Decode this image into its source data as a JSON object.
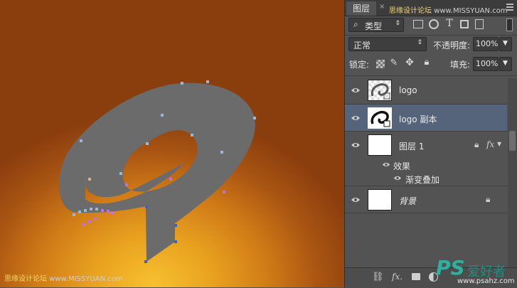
{
  "watermarks": {
    "tab_wm": {
      "a": "思缘设计论坛",
      "b": "www.MISSYUAN.com"
    },
    "canvas_wm": {
      "a": "思缘设计论坛",
      "b": "www.MISSYUAN.com"
    },
    "corner": {
      "ps": "PS",
      "cn": "爱好者",
      "url": "www.psahz.com"
    }
  },
  "panel": {
    "tab_label": "图层",
    "tab_close": "×",
    "filter_label": "类型",
    "blend_mode": "正常",
    "opacity_label": "不透明度:",
    "opacity_value": "100%",
    "lock_label": "锁定:",
    "fill_label": "填充:",
    "fill_value": "100%",
    "layers": [
      {
        "name": "logo"
      },
      {
        "name": "logo 副本"
      },
      {
        "name": "图层 1",
        "fx": "fx"
      },
      {
        "name": "背景"
      }
    ],
    "effects_label": "效果",
    "effect_name": "渐变叠加",
    "bottom_fx": "fx."
  },
  "colors": {
    "panel_bg": "#535353",
    "selected_layer": "#55647a",
    "shape_fill": "#6b6b6b",
    "canvas_glow": "#f7c030",
    "canvas_edge": "#8a3e0e"
  }
}
